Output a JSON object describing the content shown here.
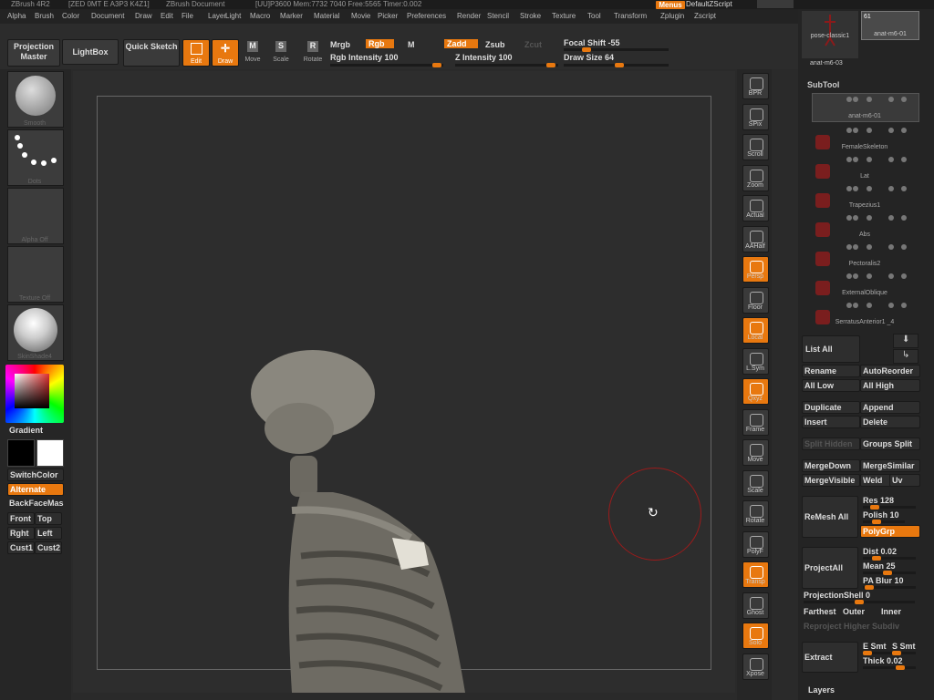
{
  "titlebar": {
    "app": "ZBrush 4R2",
    "build": "[ZED 0MT E A3P3 K4Z1]",
    "doc": "ZBrush Document",
    "stats": "[UU]P3600 Mem:7732 7040 Free:5565 Timer:0.002"
  },
  "top_right": {
    "menus_label": "Menus",
    "script_label": "DefaultZScript"
  },
  "menubar": [
    "Alpha",
    "Brush",
    "Color",
    "Document",
    "Draw",
    "Edit",
    "File",
    "Layer",
    "Light",
    "Macro",
    "Marker",
    "Material",
    "Movie",
    "Picker",
    "Preferences",
    "Render",
    "Stencil",
    "Stroke",
    "Texture",
    "Tool",
    "Transform",
    "Zplugin",
    "Zscript"
  ],
  "toolbar": {
    "projection_master": "Projection Master",
    "lightbox": "LightBox",
    "quick_sketch": "Quick Sketch",
    "edit": "Edit",
    "draw": "Draw",
    "move": "Move",
    "scale": "Scale",
    "rotate": "Rotate",
    "mrgb": "Mrgb",
    "rgb": "Rgb",
    "m": "M",
    "zadd": "Zadd",
    "zsub": "Zsub",
    "zcut": "Zcut",
    "rgb_intensity": "Rgb Intensity 100",
    "z_intensity": "Z Intensity 100",
    "focal_shift": "Focal Shift -55",
    "draw_size": "Draw Size 64"
  },
  "left_shelf": {
    "brush_caption": "Smooth",
    "stroke_caption": "Dots",
    "alpha_caption": "Alpha Off",
    "texture_caption": "Texture Off",
    "material_caption": "SkinShade4",
    "gradient": "Gradient",
    "switch_color": "SwitchColor",
    "alternate": "Alternate",
    "backface": "BackFaceMas",
    "front": "Front",
    "top": "Top",
    "right": "Rght",
    "left": "Left",
    "cust1": "Cust1",
    "cust2": "Cust2"
  },
  "right_shelf": [
    "BPR",
    "SPix",
    "Scroll",
    "Zoom",
    "Actual",
    "AAHalf",
    "Persp",
    "Floor",
    "Local",
    "L.Sym",
    "Qxyz",
    "Frame",
    "Move",
    "Scale",
    "Rotate",
    "PolyF",
    "Transp",
    "Ghost",
    "Solo",
    "Xpose"
  ],
  "tray": {
    "tool_thumbs": [
      "pose-classic1",
      "anat-m6-01",
      "anat-m6-03"
    ],
    "tool_count": "61",
    "subtool_title": "SubTool",
    "subtools": [
      "anat-m6-01",
      "FemaleSkeleton",
      "Lat",
      "Trapezius1",
      "Abs",
      "Pectoralis2",
      "ExternalOblique",
      "SerratusAnterior1 _4"
    ],
    "list_all": "List All",
    "rename": "Rename",
    "autoreorder": "AutoReorder",
    "all_low": "All Low",
    "all_high": "All High",
    "duplicate": "Duplicate",
    "append": "Append",
    "insert": "Insert",
    "delete": "Delete",
    "split_hidden": "Split Hidden",
    "groups_split": "Groups Split",
    "merge_down": "MergeDown",
    "merge_similar": "MergeSimilar",
    "merge_visible": "MergeVisible",
    "weld": "Weld",
    "uv": "Uv",
    "remesh_all": "ReMesh All",
    "res": "Res 128",
    "polish": "Polish 10",
    "polygrp": "PolyGrp",
    "project_all": "ProjectAll",
    "dist": "Dist 0.02",
    "mean": "Mean 25",
    "pa_blur": "PA Blur 10",
    "projection_shell": "ProjectionShell 0",
    "farthest": "Farthest",
    "outer": "Outer",
    "inner": "Inner",
    "reproject": "Reproject Higher Subdiv",
    "extract": "Extract",
    "e_smt": "E Smt",
    "s_smt": "S Smt",
    "thick": "Thick 0.02",
    "layers": "Layers"
  }
}
